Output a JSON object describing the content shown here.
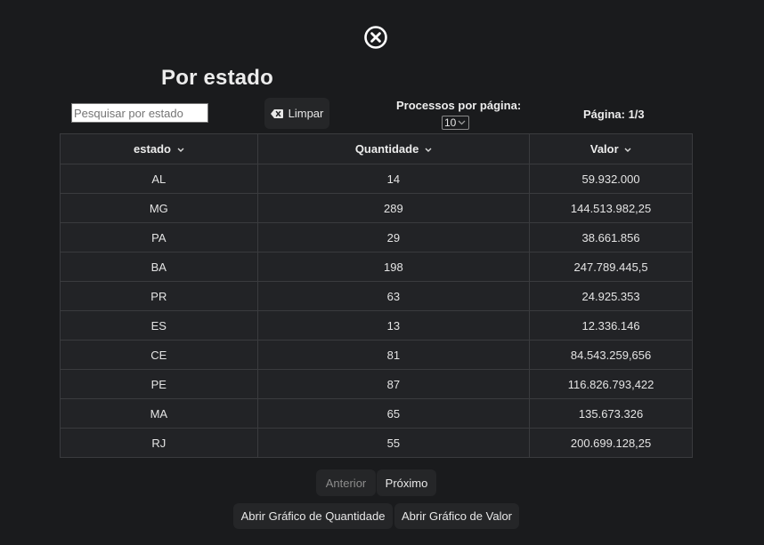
{
  "modal": {
    "title": "Por estado",
    "close_icon": "close-circle-icon"
  },
  "controls": {
    "search_placeholder": "Pesquisar por estado",
    "search_value": "",
    "clear_label": "Limpar",
    "clear_icon": "backspace-icon",
    "per_page_label": "Processos por página:",
    "per_page_value": "10",
    "page_info": "Página: 1/3"
  },
  "table": {
    "columns": [
      "estado",
      "Quantidade",
      "Valor"
    ],
    "rows": [
      [
        "AL",
        "14",
        "59.932.000"
      ],
      [
        "MG",
        "289",
        "144.513.982,25"
      ],
      [
        "PA",
        "29",
        "38.661.856"
      ],
      [
        "BA",
        "198",
        "247.789.445,5"
      ],
      [
        "PR",
        "63",
        "24.925.353"
      ],
      [
        "ES",
        "13",
        "12.336.146"
      ],
      [
        "CE",
        "81",
        "84.543.259,656"
      ],
      [
        "PE",
        "87",
        "116.826.793,422"
      ],
      [
        "MA",
        "65",
        "135.673.326"
      ],
      [
        "RJ",
        "55",
        "200.699.128,25"
      ]
    ]
  },
  "pagination": {
    "prev_label": "Anterior",
    "next_label": "Próximo"
  },
  "actions": {
    "chart_quantity_label": "Abrir Gráfico de Quantidade",
    "chart_value_label": "Abrir Gráfico de Valor"
  },
  "colors": {
    "background": "#1a1b1d",
    "table_bg": "#222326",
    "button_bg": "#252628",
    "text": "#e6e6e6",
    "muted_text": "#8c8c8c"
  }
}
